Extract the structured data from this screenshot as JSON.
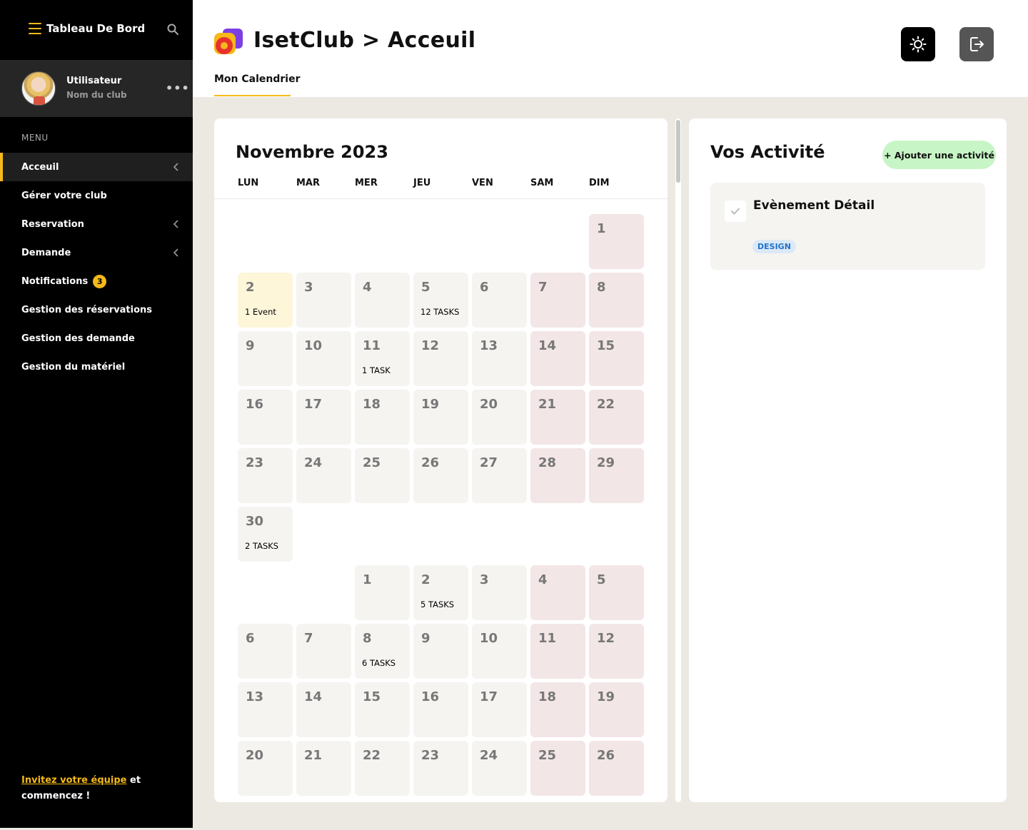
{
  "sidebar": {
    "title": "Tableau De Bord",
    "user": {
      "name": "Utilisateur",
      "club": "Nom du club",
      "more": "•••"
    },
    "menu_label": "MENU",
    "items": [
      {
        "label": "Acceuil",
        "active": true,
        "has_chevron": true
      },
      {
        "label": "Gérer votre club",
        "has_chevron": false
      },
      {
        "label": "Reservation",
        "has_chevron": true
      },
      {
        "label": "Demande",
        "has_chevron": true
      },
      {
        "label": "Notifications",
        "badge": "3"
      },
      {
        "label": "Gestion des réservations"
      },
      {
        "label": "Gestion des demande"
      },
      {
        "label": "Gestion du matériel"
      }
    ],
    "invite": {
      "highlight": "Invitez votre équipe",
      "rest1": " et",
      "rest2": "commencez !"
    }
  },
  "header": {
    "title": "IsetClub > Acceuil",
    "tab": "Mon Calendrier"
  },
  "calendar": {
    "title": "Novembre 2023",
    "weekdays": [
      "LUN",
      "MAR",
      "MER",
      "JEU",
      "VEN",
      "SAM",
      "DIM"
    ],
    "days": [
      {
        "d": "1",
        "col": 6,
        "row": 0
      },
      {
        "d": "2",
        "col": 0,
        "row": 1,
        "label": "1 Event",
        "today": true
      },
      {
        "d": "3",
        "col": 1,
        "row": 1
      },
      {
        "d": "4",
        "col": 2,
        "row": 1
      },
      {
        "d": "5",
        "col": 3,
        "row": 1,
        "label": "12 TASKS"
      },
      {
        "d": "6",
        "col": 4,
        "row": 1
      },
      {
        "d": "7",
        "col": 5,
        "row": 1
      },
      {
        "d": "8",
        "col": 6,
        "row": 1
      },
      {
        "d": "9",
        "col": 0,
        "row": 2
      },
      {
        "d": "10",
        "col": 1,
        "row": 2
      },
      {
        "d": "11",
        "col": 2,
        "row": 2,
        "label": "1 TASK"
      },
      {
        "d": "12",
        "col": 3,
        "row": 2
      },
      {
        "d": "13",
        "col": 4,
        "row": 2
      },
      {
        "d": "14",
        "col": 5,
        "row": 2
      },
      {
        "d": "15",
        "col": 6,
        "row": 2
      },
      {
        "d": "16",
        "col": 0,
        "row": 3
      },
      {
        "d": "17",
        "col": 1,
        "row": 3
      },
      {
        "d": "18",
        "col": 2,
        "row": 3
      },
      {
        "d": "19",
        "col": 3,
        "row": 3
      },
      {
        "d": "20",
        "col": 4,
        "row": 3
      },
      {
        "d": "21",
        "col": 5,
        "row": 3
      },
      {
        "d": "22",
        "col": 6,
        "row": 3
      },
      {
        "d": "23",
        "col": 0,
        "row": 4
      },
      {
        "d": "24",
        "col": 1,
        "row": 4
      },
      {
        "d": "25",
        "col": 2,
        "row": 4
      },
      {
        "d": "26",
        "col": 3,
        "row": 4
      },
      {
        "d": "27",
        "col": 4,
        "row": 4
      },
      {
        "d": "28",
        "col": 5,
        "row": 4
      },
      {
        "d": "29",
        "col": 6,
        "row": 4
      },
      {
        "d": "30",
        "col": 0,
        "row": 5,
        "label": "2 TASKS"
      },
      {
        "d": "1",
        "col": 2,
        "row": 6
      },
      {
        "d": "2",
        "col": 3,
        "row": 6,
        "label": "5 TASKS"
      },
      {
        "d": "3",
        "col": 4,
        "row": 6
      },
      {
        "d": "4",
        "col": 5,
        "row": 6
      },
      {
        "d": "5",
        "col": 6,
        "row": 6
      },
      {
        "d": "6",
        "col": 0,
        "row": 7
      },
      {
        "d": "7",
        "col": 1,
        "row": 7
      },
      {
        "d": "8",
        "col": 2,
        "row": 7,
        "label": "6 TASKS"
      },
      {
        "d": "9",
        "col": 3,
        "row": 7
      },
      {
        "d": "10",
        "col": 4,
        "row": 7
      },
      {
        "d": "11",
        "col": 5,
        "row": 7
      },
      {
        "d": "12",
        "col": 6,
        "row": 7
      },
      {
        "d": "13",
        "col": 0,
        "row": 8
      },
      {
        "d": "14",
        "col": 1,
        "row": 8
      },
      {
        "d": "15",
        "col": 2,
        "row": 8
      },
      {
        "d": "16",
        "col": 3,
        "row": 8
      },
      {
        "d": "17",
        "col": 4,
        "row": 8
      },
      {
        "d": "18",
        "col": 5,
        "row": 8
      },
      {
        "d": "19",
        "col": 6,
        "row": 8
      },
      {
        "d": "20",
        "col": 0,
        "row": 9
      },
      {
        "d": "21",
        "col": 1,
        "row": 9
      },
      {
        "d": "22",
        "col": 2,
        "row": 9
      },
      {
        "d": "23",
        "col": 3,
        "row": 9
      },
      {
        "d": "24",
        "col": 4,
        "row": 9
      },
      {
        "d": "25",
        "col": 5,
        "row": 9
      },
      {
        "d": "26",
        "col": 6,
        "row": 9
      }
    ]
  },
  "activities": {
    "title": "Vos Activité",
    "add_label": "+ Ajouter une activité",
    "items": [
      {
        "name": "Evènement Détail",
        "tag": "DESIGN"
      }
    ]
  },
  "icons": {
    "menu": "hamburger-icon",
    "search": "search-icon",
    "theme": "sun-icon",
    "logout": "logout-icon",
    "chevron": "chevron-left-icon",
    "check": "check-icon"
  },
  "colors": {
    "accent": "#f5b919",
    "weekend": "#f3e6e6",
    "today": "#fdf6d8",
    "add_button": "#c8f5c5",
    "tag": "#2073c8"
  }
}
